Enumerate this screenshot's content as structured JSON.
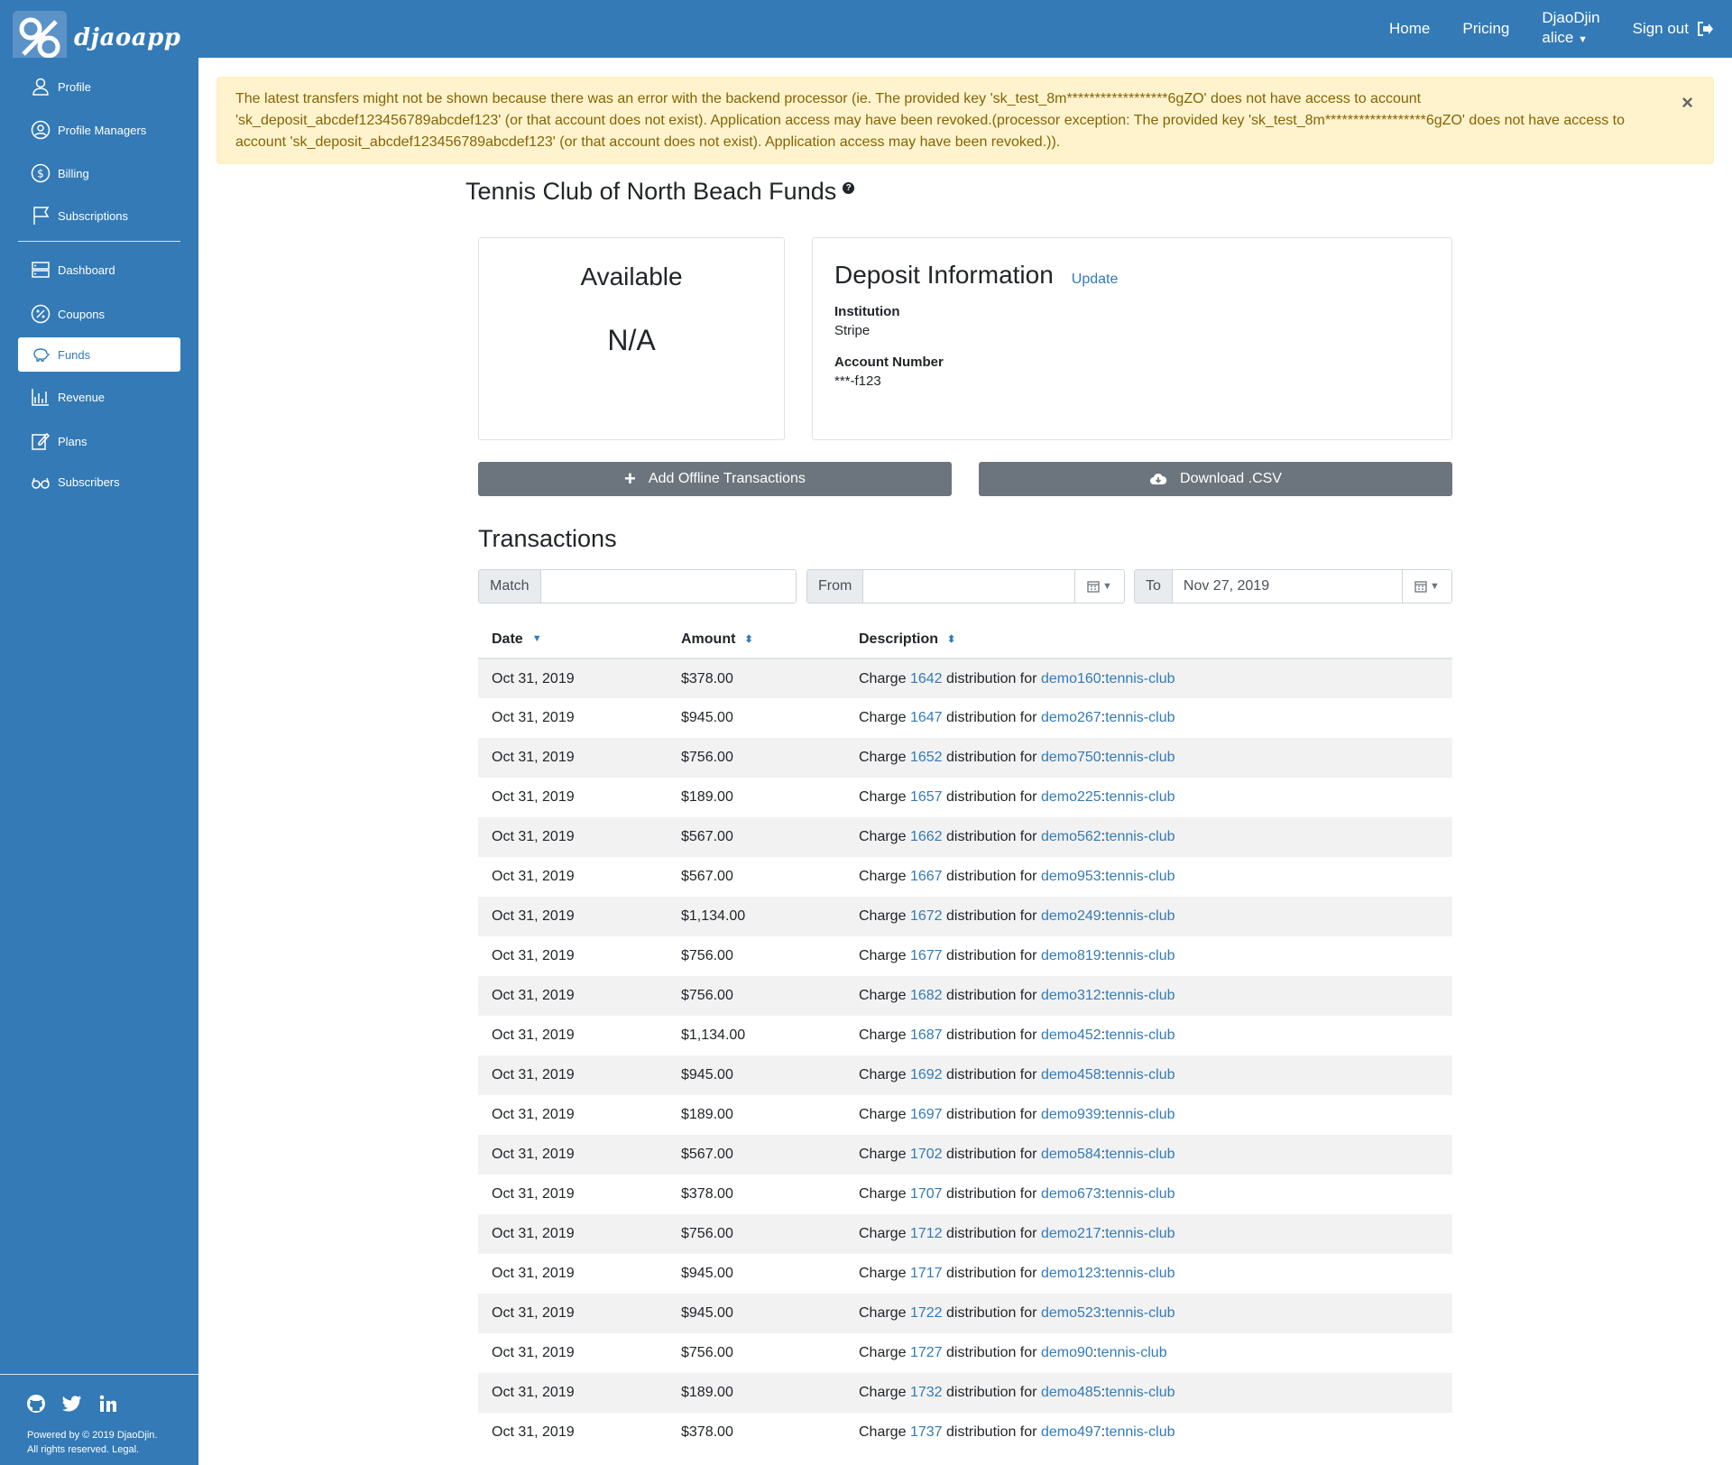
{
  "brand": {
    "name": "djaoapp"
  },
  "topnav": {
    "home": "Home",
    "pricing": "Pricing",
    "user_line1": "DjaoDjin",
    "user_line2": "alice",
    "signout": "Sign out"
  },
  "sidebar": {
    "items": [
      {
        "label": "Profile",
        "icon": "user-icon"
      },
      {
        "label": "Profile Managers",
        "icon": "user-circle-icon"
      },
      {
        "label": "Billing",
        "icon": "dollar-icon"
      },
      {
        "label": "Subscriptions",
        "icon": "flag-icon"
      },
      {
        "label": "Dashboard",
        "icon": "server-icon"
      },
      {
        "label": "Coupons",
        "icon": "percent-icon"
      },
      {
        "label": "Funds",
        "icon": "piggy-bank-icon"
      },
      {
        "label": "Revenue",
        "icon": "chart-icon"
      },
      {
        "label": "Plans",
        "icon": "edit-icon"
      },
      {
        "label": "Subscribers",
        "icon": "glasses-icon"
      }
    ],
    "footer_line1": "Powered by © 2019 DjaoDjin.",
    "footer_line2": "All rights reserved. Legal."
  },
  "alert": {
    "text": "The latest transfers might not be shown because there was an error with the backend processor (ie. The provided key 'sk_test_8m******************6gZO' does not have access to account 'sk_deposit_abcdef123456789abcdef123' (or that account does not exist). Application access may have been revoked.(processor exception: The provided key 'sk_test_8m******************6gZO' does not have access to account 'sk_deposit_abcdef123456789abcdef123' (or that account does not exist). Application access may have been revoked.)).",
    "close": "×"
  },
  "page": {
    "title": "Tennis Club of North Beach Funds"
  },
  "available": {
    "heading": "Available",
    "value": "N/A"
  },
  "deposit": {
    "heading": "Deposit Information",
    "update": "Update",
    "institution_label": "Institution",
    "institution_value": "Stripe",
    "account_label": "Account Number",
    "account_value": "***-f123"
  },
  "actions": {
    "add": "Add Offline Transactions",
    "download": "Download .CSV"
  },
  "transactions": {
    "title": "Transactions",
    "match_label": "Match",
    "from_label": "From",
    "to_label": "To",
    "to_value": "Nov 27, 2019",
    "headers": {
      "date": "Date",
      "amount": "Amount",
      "description": "Description"
    },
    "rows": [
      {
        "date": "Oct 31, 2019",
        "amount": "$378.00",
        "charge": "1642",
        "user": "demo160",
        "org": "tennis-club"
      },
      {
        "date": "Oct 31, 2019",
        "amount": "$945.00",
        "charge": "1647",
        "user": "demo267",
        "org": "tennis-club"
      },
      {
        "date": "Oct 31, 2019",
        "amount": "$756.00",
        "charge": "1652",
        "user": "demo750",
        "org": "tennis-club"
      },
      {
        "date": "Oct 31, 2019",
        "amount": "$189.00",
        "charge": "1657",
        "user": "demo225",
        "org": "tennis-club"
      },
      {
        "date": "Oct 31, 2019",
        "amount": "$567.00",
        "charge": "1662",
        "user": "demo562",
        "org": "tennis-club"
      },
      {
        "date": "Oct 31, 2019",
        "amount": "$567.00",
        "charge": "1667",
        "user": "demo953",
        "org": "tennis-club"
      },
      {
        "date": "Oct 31, 2019",
        "amount": "$1,134.00",
        "charge": "1672",
        "user": "demo249",
        "org": "tennis-club"
      },
      {
        "date": "Oct 31, 2019",
        "amount": "$756.00",
        "charge": "1677",
        "user": "demo819",
        "org": "tennis-club"
      },
      {
        "date": "Oct 31, 2019",
        "amount": "$756.00",
        "charge": "1682",
        "user": "demo312",
        "org": "tennis-club"
      },
      {
        "date": "Oct 31, 2019",
        "amount": "$1,134.00",
        "charge": "1687",
        "user": "demo452",
        "org": "tennis-club"
      },
      {
        "date": "Oct 31, 2019",
        "amount": "$945.00",
        "charge": "1692",
        "user": "demo458",
        "org": "tennis-club"
      },
      {
        "date": "Oct 31, 2019",
        "amount": "$189.00",
        "charge": "1697",
        "user": "demo939",
        "org": "tennis-club"
      },
      {
        "date": "Oct 31, 2019",
        "amount": "$567.00",
        "charge": "1702",
        "user": "demo584",
        "org": "tennis-club"
      },
      {
        "date": "Oct 31, 2019",
        "amount": "$378.00",
        "charge": "1707",
        "user": "demo673",
        "org": "tennis-club"
      },
      {
        "date": "Oct 31, 2019",
        "amount": "$756.00",
        "charge": "1712",
        "user": "demo217",
        "org": "tennis-club"
      },
      {
        "date": "Oct 31, 2019",
        "amount": "$945.00",
        "charge": "1717",
        "user": "demo123",
        "org": "tennis-club"
      },
      {
        "date": "Oct 31, 2019",
        "amount": "$945.00",
        "charge": "1722",
        "user": "demo523",
        "org": "tennis-club"
      },
      {
        "date": "Oct 31, 2019",
        "amount": "$756.00",
        "charge": "1727",
        "user": "demo90",
        "org": "tennis-club"
      },
      {
        "date": "Oct 31, 2019",
        "amount": "$189.00",
        "charge": "1732",
        "user": "demo485",
        "org": "tennis-club"
      },
      {
        "date": "Oct 31, 2019",
        "amount": "$378.00",
        "charge": "1737",
        "user": "demo497",
        "org": "tennis-club"
      }
    ],
    "desc_prefix": "Charge",
    "desc_middle": "distribution for"
  },
  "colors": {
    "primary": "#337ab7",
    "alert_bg": "#fff3cd",
    "alert_text": "#856404",
    "button": "#6c757d"
  }
}
